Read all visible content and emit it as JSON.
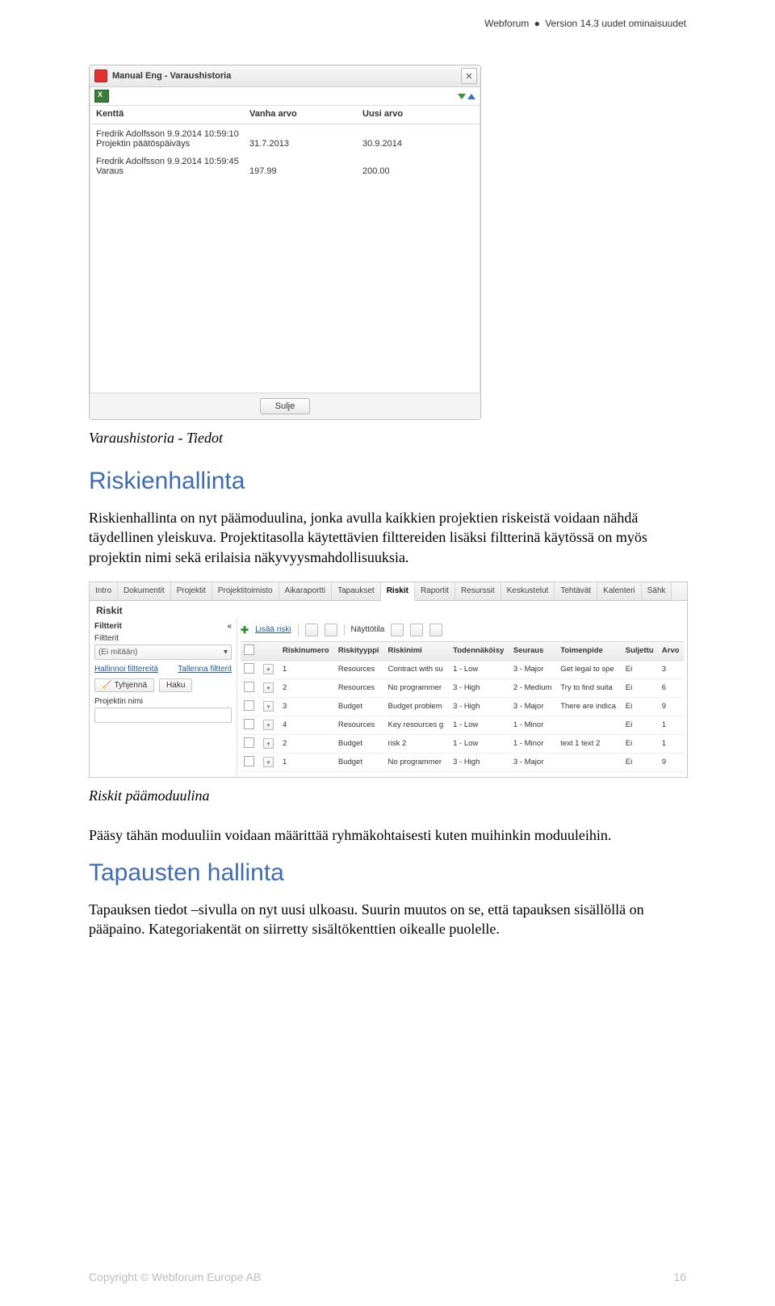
{
  "header": {
    "brand": "Webforum",
    "version": "Version 14.3 uudet ominaisuudet"
  },
  "dialog": {
    "title": "Manual Eng - Varaushistoria",
    "cols": {
      "field": "Kenttä",
      "old": "Vanha arvo",
      "new": "Uusi arvo"
    },
    "entries": [
      {
        "meta": "Fredrik Adolfsson 9.9.2014 10:59:10",
        "field": "Projektin päätöspäiväys",
        "old": "31.7.2013",
        "new": "30.9.2014"
      },
      {
        "meta": "Fredrik Adolfsson 9.9.2014 10:59:45",
        "field": "Varaus",
        "old": "197.99",
        "new": "200.00"
      }
    ],
    "close_label": "Sulje"
  },
  "caption1": "Varaushistoria - Tiedot",
  "section1": {
    "title": "Riskienhallinta",
    "body": "Riskienhallinta on nyt päämoduulina, jonka avulla kaikkien projektien riskeistä voidaan nähdä täydellinen yleiskuva. Projektitasolla käytettävien filttereiden lisäksi filtterinä käytössä on myös projektin nimi sekä erilaisia näkyvyysmahdollisuuksia."
  },
  "riskit": {
    "tabs": [
      "Intro",
      "Dokumentit",
      "Projektit",
      "Projektitoimisto",
      "Aikaraportti",
      "Tapaukset",
      "Riskit",
      "Raportit",
      "Resurssit",
      "Keskustelut",
      "Tehtävät",
      "Kalenteri",
      "Sähk"
    ],
    "active_tab": "Riskit",
    "panel_title": "Riskit",
    "left": {
      "filters_label": "Filtterit",
      "none_label": "(Ei mitään)",
      "manage_filters": "Hallinnoi filttereitä",
      "save_filters": "Tallenna filtterit",
      "clear": "Tyhjennä",
      "search": "Haku",
      "project_name": "Projektin nimi"
    },
    "toolbar": {
      "add": "Lisää riski",
      "view": "Näyttötila"
    },
    "columns": [
      "",
      "",
      "Riskinumero",
      "Riskityyppi",
      "Riskinimi",
      "Todennäköisy",
      "Seuraus",
      "Toimenpide",
      "Suljettu",
      "Arvo"
    ],
    "rows": [
      {
        "num": "1",
        "type": "Resources",
        "name": "Contract with su",
        "prob": "1 - Low",
        "cons": "3 - Major",
        "action": "Get legal to spe",
        "closed": "Ei",
        "value": "3"
      },
      {
        "num": "2",
        "type": "Resources",
        "name": "No programmer",
        "prob": "3 - High",
        "cons": "2 - Medium",
        "action": "Try to find suita",
        "closed": "Ei",
        "value": "6"
      },
      {
        "num": "3",
        "type": "Budget",
        "name": "Budget problem",
        "prob": "3 - High",
        "cons": "3 - Major",
        "action": "There are indica",
        "closed": "Ei",
        "value": "9"
      },
      {
        "num": "4",
        "type": "Resources",
        "name": "Key resources g",
        "prob": "1 - Low",
        "cons": "1 - Minor",
        "action": "",
        "closed": "Ei",
        "value": "1"
      },
      {
        "num": "2",
        "type": "Budget",
        "name": "risk 2",
        "prob": "1 - Low",
        "cons": "1 - Minor",
        "action": "text 1 text 2",
        "closed": "Ei",
        "value": "1"
      },
      {
        "num": "1",
        "type": "Budget",
        "name": "No programmer",
        "prob": "3 - High",
        "cons": "3 - Major",
        "action": "",
        "closed": "Ei",
        "value": "9"
      }
    ]
  },
  "caption2": "Riskit päämoduulina",
  "para2": "Pääsy tähän moduuliin voidaan määrittää ryhmäkohtaisesti kuten muihinkin moduuleihin.",
  "section2": {
    "title": "Tapausten hallinta",
    "body": "Tapauksen tiedot –sivulla on nyt uusi ulkoasu. Suurin muutos on se, että tapauksen sisällöllä on pääpaino. Kategoriakentät on siirretty sisältökenttien oikealle puolelle."
  },
  "footer": {
    "copyright": "Copyright © Webforum Europe AB",
    "page": "16"
  }
}
